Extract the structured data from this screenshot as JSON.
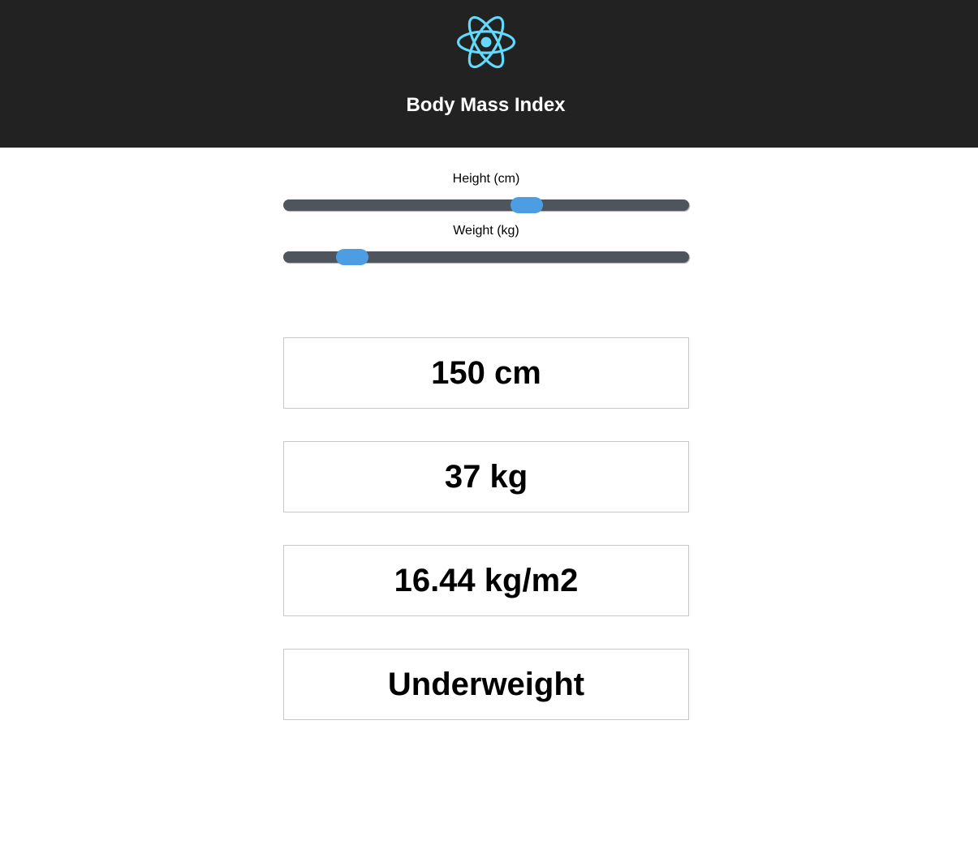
{
  "header": {
    "title": "Body Mass Index",
    "logo_icon": "react-atom-icon",
    "background": "#222222",
    "logo_color": "#61dafb"
  },
  "sliders": {
    "height": {
      "label": "Height (cm)",
      "value_fraction": 0.6
    },
    "weight": {
      "label": "Weight (kg)",
      "value_fraction": 0.17
    },
    "track_color": "#4f555d",
    "thumb_color": "#4d9de2"
  },
  "results": {
    "height": "150 cm",
    "weight": "37 kg",
    "bmi": "16.44 kg/m2",
    "category": "Underweight"
  }
}
